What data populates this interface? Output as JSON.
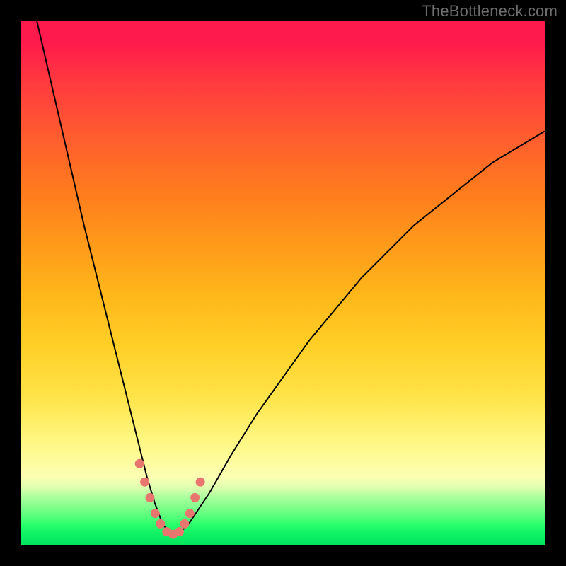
{
  "watermark": "TheBottleneck.com",
  "chart_data": {
    "type": "line",
    "title": "",
    "xlabel": "",
    "ylabel": "",
    "xlim": [
      0,
      100
    ],
    "ylim": [
      0,
      100
    ],
    "background_gradient": {
      "top": "#ff1a4d",
      "bottom": "#00e45e",
      "stops": [
        "red",
        "orange",
        "yellow",
        "green"
      ]
    },
    "series": [
      {
        "name": "bottleneck-curve",
        "x": [
          3,
          6,
          9,
          12,
          15,
          18,
          20,
          22,
          24,
          25.5,
          27,
          28.5,
          30,
          32,
          36,
          40,
          45,
          50,
          55,
          60,
          65,
          70,
          75,
          80,
          85,
          90,
          95,
          100
        ],
        "y": [
          100,
          87,
          74,
          61,
          49,
          37,
          29,
          21,
          13,
          8,
          4,
          2,
          2,
          4,
          10,
          17,
          25,
          32,
          39,
          45,
          51,
          56,
          61,
          65,
          69,
          73,
          76,
          79
        ]
      }
    ],
    "markers": {
      "name": "highlighted-range",
      "color": "#e8766f",
      "points_x": [
        22.6,
        23.6,
        24.6,
        25.6,
        26.6,
        27.8,
        29.0,
        30.2,
        31.2,
        32.2,
        33.2,
        34.2
      ],
      "points_y": [
        15.5,
        12.0,
        9.0,
        6.0,
        4.0,
        2.5,
        2.0,
        2.5,
        4.0,
        6.0,
        9.0,
        12.0
      ]
    },
    "annotations": []
  }
}
